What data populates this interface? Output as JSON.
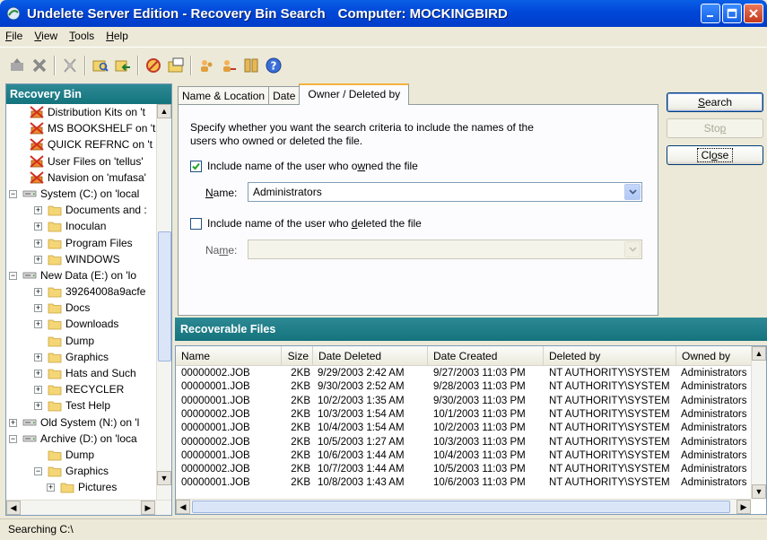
{
  "window": {
    "title": "Undelete Server Edition - Recovery Bin Search",
    "computer_label": "Computer: MOCKINGBIRD",
    "controls": [
      "minimize",
      "maximize",
      "close"
    ]
  },
  "menu": {
    "items": [
      {
        "label": "File",
        "accel": "F",
        "rest": "ile"
      },
      {
        "label": "View",
        "accel": "V",
        "rest": "iew"
      },
      {
        "label": "Tools",
        "accel": "T",
        "rest": "ools"
      },
      {
        "label": "Help",
        "accel": "H",
        "rest": "elp"
      }
    ]
  },
  "toolbar": {
    "icons": [
      "recover-icon",
      "delete-icon",
      "purge-icon",
      "search-icon",
      "back-icon",
      "settings-icon",
      "folder-icon",
      "users-icon",
      "properties-icon",
      "help-icon"
    ]
  },
  "left_pane": {
    "title": "Recovery Bin",
    "tree": [
      {
        "label": "Distribution Kits on 't",
        "indent": 1,
        "icon": "network-bin"
      },
      {
        "label": "MS BOOKSHELF on 't",
        "indent": 1,
        "icon": "network-bin"
      },
      {
        "label": "QUICK REFRNC on 't",
        "indent": 1,
        "icon": "network-bin"
      },
      {
        "label": "User Files on 'tellus'",
        "indent": 1,
        "icon": "network-bin"
      },
      {
        "label": "Navision on 'mufasa'",
        "indent": 1,
        "icon": "network-bin"
      },
      {
        "label": "System (C:) on 'local",
        "indent": 0,
        "icon": "drive",
        "expander": "-"
      },
      {
        "label": "Documents and :",
        "indent": 2,
        "icon": "folder",
        "expander": "+"
      },
      {
        "label": "Inoculan",
        "indent": 2,
        "icon": "folder",
        "expander": "+"
      },
      {
        "label": "Program Files",
        "indent": 2,
        "icon": "folder",
        "expander": "+"
      },
      {
        "label": "WINDOWS",
        "indent": 2,
        "icon": "folder",
        "expander": "+"
      },
      {
        "label": "New Data (E:) on 'lo",
        "indent": 0,
        "icon": "drive",
        "expander": "-"
      },
      {
        "label": "39264008a9acfe",
        "indent": 2,
        "icon": "folder",
        "expander": "+"
      },
      {
        "label": "Docs",
        "indent": 2,
        "icon": "folder",
        "expander": "+"
      },
      {
        "label": "Downloads",
        "indent": 2,
        "icon": "folder",
        "expander": "+"
      },
      {
        "label": "Dump",
        "indent": 2,
        "icon": "folder"
      },
      {
        "label": "Graphics",
        "indent": 2,
        "icon": "folder",
        "expander": "+"
      },
      {
        "label": "Hats and Such",
        "indent": 2,
        "icon": "folder",
        "expander": "+"
      },
      {
        "label": "RECYCLER",
        "indent": 2,
        "icon": "folder",
        "expander": "+"
      },
      {
        "label": "Test Help",
        "indent": 2,
        "icon": "folder",
        "expander": "+"
      },
      {
        "label": "Old System (N:) on 'l",
        "indent": 0,
        "icon": "drive",
        "expander": "+"
      },
      {
        "label": "Archive (D:) on 'loca",
        "indent": 0,
        "icon": "drive",
        "expander": "-"
      },
      {
        "label": "Dump",
        "indent": 2,
        "icon": "folder"
      },
      {
        "label": "Graphics",
        "indent": 2,
        "icon": "folder",
        "expander": "-"
      },
      {
        "label": "Pictures",
        "indent": 3,
        "icon": "folder",
        "expander": "+"
      }
    ]
  },
  "tabs": [
    {
      "label": "Name & Location",
      "active": false
    },
    {
      "label": "Date",
      "active": false
    },
    {
      "label": "Owner / Deleted by",
      "active": true
    }
  ],
  "owner_tab": {
    "description": "Specify whether you want the search criteria to include the names of the users who owned or deleted the file.",
    "owner_checkbox": {
      "pre": "Include name of the user who o",
      "accel": "w",
      "post": "ned the file",
      "checked": true
    },
    "owner_name_label": {
      "accel": "N",
      "post": "ame:"
    },
    "owner_name_value": "Administrators",
    "deleter_checkbox": {
      "pre": "Include name of the user who ",
      "accel": "d",
      "post": "eleted the file",
      "checked": false
    },
    "deleter_name_label": {
      "pre": "Na",
      "accel": "m",
      "post": "e:"
    },
    "deleter_name_value": ""
  },
  "buttons": {
    "search": {
      "accel": "S",
      "post": "earch"
    },
    "stop": {
      "pre": "Sto",
      "accel": "p",
      "post": ""
    },
    "close": {
      "pre": "Cl",
      "accel": "o",
      "post": "se"
    }
  },
  "results": {
    "title": "Recoverable Files",
    "columns": [
      "Name",
      "Size",
      "Date Deleted",
      "Date Created",
      "Deleted by",
      "Owned by"
    ],
    "rows": [
      [
        "00000002.JOB",
        "2KB",
        "9/29/2003 2:42 AM",
        "9/27/2003 11:03 PM",
        "NT AUTHORITY\\SYSTEM",
        "Administrators"
      ],
      [
        "00000001.JOB",
        "2KB",
        "9/30/2003 2:52 AM",
        "9/28/2003 11:03 PM",
        "NT AUTHORITY\\SYSTEM",
        "Administrators"
      ],
      [
        "00000001.JOB",
        "2KB",
        "10/2/2003 1:35 AM",
        "9/30/2003 11:03 PM",
        "NT AUTHORITY\\SYSTEM",
        "Administrators"
      ],
      [
        "00000002.JOB",
        "2KB",
        "10/3/2003 1:54 AM",
        "10/1/2003 11:03 PM",
        "NT AUTHORITY\\SYSTEM",
        "Administrators"
      ],
      [
        "00000001.JOB",
        "2KB",
        "10/4/2003 1:54 AM",
        "10/2/2003 11:03 PM",
        "NT AUTHORITY\\SYSTEM",
        "Administrators"
      ],
      [
        "00000002.JOB",
        "2KB",
        "10/5/2003 1:27 AM",
        "10/3/2003 11:03 PM",
        "NT AUTHORITY\\SYSTEM",
        "Administrators"
      ],
      [
        "00000001.JOB",
        "2KB",
        "10/6/2003 1:44 AM",
        "10/4/2003 11:03 PM",
        "NT AUTHORITY\\SYSTEM",
        "Administrators"
      ],
      [
        "00000002.JOB",
        "2KB",
        "10/7/2003 1:44 AM",
        "10/5/2003 11:03 PM",
        "NT AUTHORITY\\SYSTEM",
        "Administrators"
      ],
      [
        "00000001.JOB",
        "2KB",
        "10/8/2003 1:43 AM",
        "10/6/2003 11:03 PM",
        "NT AUTHORITY\\SYSTEM",
        "Administrators"
      ]
    ]
  },
  "status": {
    "text": "Searching C:\\"
  }
}
